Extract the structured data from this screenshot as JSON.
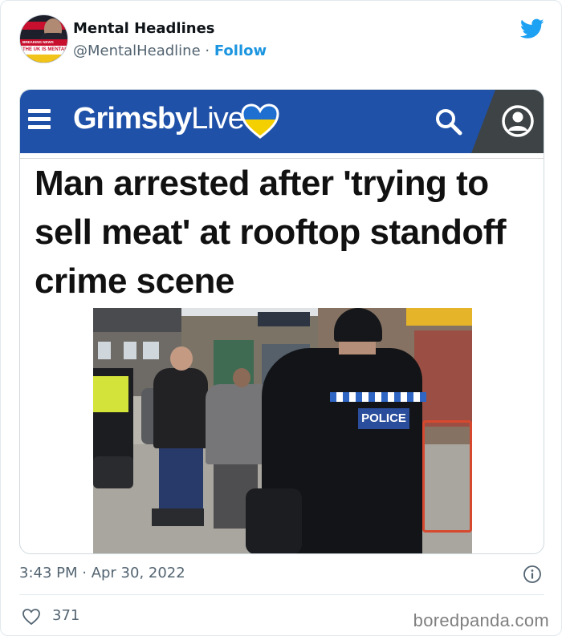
{
  "tweet": {
    "author": {
      "display_name": "Mental Headlines",
      "handle": "@MentalHeadline",
      "separator": "·",
      "follow_label": "Follow",
      "avatar_caption": {
        "top": "BREAKING NEWS",
        "main": "THE UK IS MENTAL"
      }
    },
    "twitter_icon": "twitter-bird-icon",
    "brand_color": "#1da1f2",
    "footer": {
      "timestamp": "3:43 PM · Apr 30, 2022",
      "info_icon": "info-icon",
      "like_icon": "heart-icon",
      "like_count": "371"
    }
  },
  "embedded_article": {
    "site_bar_color": "#1f51a8",
    "logo_bold": "Grimsby",
    "logo_light": "Live",
    "headline": "Man arrested after 'trying to sell meat' at rooftop standoff crime scene",
    "photo_police_label": "POLICE",
    "icons": [
      "menu-icon",
      "ukraine-heart-icon",
      "search-icon",
      "account-icon"
    ]
  },
  "watermark": "boredpanda.com"
}
